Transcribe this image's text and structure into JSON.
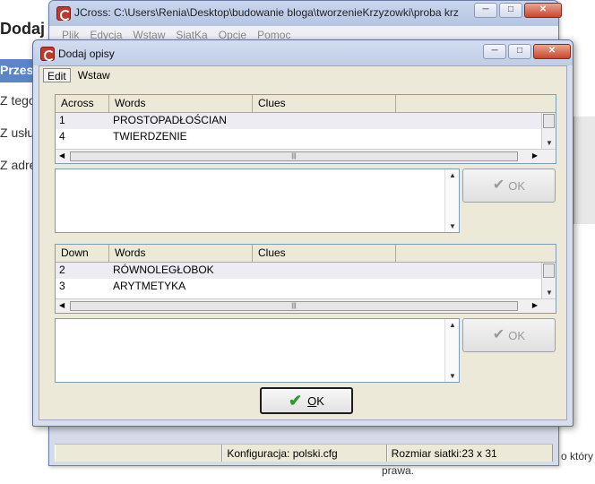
{
  "background": {
    "title": "Dodaj o",
    "nav_label": "Przes",
    "lines": [
      "Z tego",
      "Z usłu",
      "Z adre"
    ],
    "bottom_right_text": "o który",
    "bottom_text2": "prawa."
  },
  "main_window": {
    "title": "JCross: C:\\Users\\Renia\\Desktop\\budowanie bloga\\tworzenieKrzyzowki\\proba krz...",
    "menu": [
      "Plik",
      "Edycja",
      "Wstaw",
      "SiatKa",
      "Opcje",
      "Pomoc"
    ],
    "window_buttons": [
      "minimize",
      "maximize",
      "close"
    ],
    "status": {
      "config": "Konfiguracja: polski.cfg",
      "grid_size": "Rozmiar siatki:23 x 31"
    }
  },
  "dialog": {
    "title": "Dodaj opisy",
    "menu": [
      "Edit",
      "Wstaw"
    ],
    "across": {
      "headers": [
        "Across",
        "Words",
        "Clues"
      ],
      "rows": [
        {
          "num": "1",
          "word": "PROSTOPADŁOŚCIAN",
          "clue": ""
        },
        {
          "num": "4",
          "word": "TWIERDZENIE",
          "clue": ""
        }
      ]
    },
    "down": {
      "headers": [
        "Down",
        "Words",
        "Clues"
      ],
      "rows": [
        {
          "num": "2",
          "word": "RÓWNOLEGŁOBOK",
          "clue": ""
        },
        {
          "num": "3",
          "word": "ARYTMETYKA",
          "clue": ""
        }
      ]
    },
    "ok_small_label": "OK",
    "ok_main_label": "OK",
    "ok_main_underlined": "O",
    "ok_main_rest": "K"
  },
  "icons": {
    "app": "jcross-app-icon",
    "check": "check-icon"
  },
  "colors": {
    "check_green": "#2a9d2a",
    "accent_blue": "#5a86c7"
  }
}
